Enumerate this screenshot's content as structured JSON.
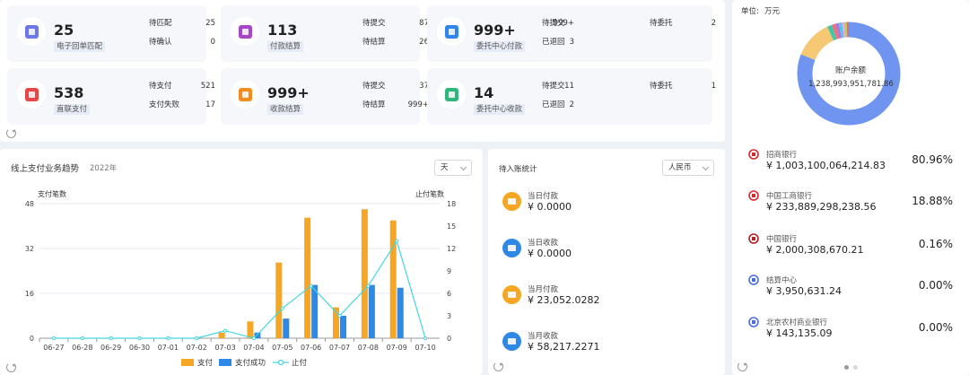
{
  "stats": {
    "cards": [
      {
        "main": "25",
        "sub": "电子回单匹配",
        "icon_color": "#6b78e5",
        "icon": "receipt-icon",
        "kv": [
          {
            "label": "待匹配",
            "value": "25"
          },
          {
            "label": "待确认",
            "value": "0"
          }
        ]
      },
      {
        "main": "113",
        "sub": "付款结算",
        "icon_color": "#a547c8",
        "icon": "payment-icon",
        "kv": [
          {
            "label": "待提交",
            "value": "87"
          },
          {
            "label": "待结算",
            "value": "26"
          }
        ]
      },
      {
        "main": "999+",
        "sub": "委托中心付款",
        "icon_color": "#2f86e8",
        "icon": "wallet-icon",
        "kv": [
          {
            "label": "待提交",
            "value": "999+"
          },
          {
            "label": "已退回",
            "value": "3"
          },
          {
            "label": "待委托",
            "value": "2"
          }
        ]
      },
      {
        "main": "538",
        "sub": "直联支付",
        "icon_color": "#e84646",
        "icon": "card-icon",
        "kv": [
          {
            "label": "待支付",
            "value": "521"
          },
          {
            "label": "支付失败",
            "value": "17"
          }
        ]
      },
      {
        "main": "999+",
        "sub": "收款结算",
        "icon_color": "#f28c1c",
        "icon": "collect-icon",
        "kv": [
          {
            "label": "待提交",
            "value": "37"
          },
          {
            "label": "待结算",
            "value": "999+"
          }
        ]
      },
      {
        "main": "14",
        "sub": "委托中心收款",
        "icon_color": "#2fb67c",
        "icon": "document-icon",
        "kv": [
          {
            "label": "待提交",
            "value": "11"
          },
          {
            "label": "已退回",
            "value": "2"
          },
          {
            "label": "待委托",
            "value": "1"
          }
        ]
      }
    ]
  },
  "trend": {
    "title": "线上支付业务趋势",
    "year": "2022年",
    "select_value": "天"
  },
  "chart_data": {
    "type": "bar",
    "categories": [
      "06-27",
      "06-28",
      "06-29",
      "06-30",
      "07-01",
      "07-02",
      "07-03",
      "07-04",
      "07-05",
      "07-06",
      "07-07",
      "07-08",
      "07-09",
      "07-10"
    ],
    "y_left_label": "支付笔数",
    "y_right_label": "止付笔数",
    "y_left_ticks": [
      "0",
      "16",
      "32",
      "48"
    ],
    "y_right_ticks": [
      "0",
      "3",
      "6",
      "9",
      "12",
      "15",
      "18"
    ],
    "ylim_left": [
      0,
      48
    ],
    "ylim_right": [
      0,
      18
    ],
    "series": [
      {
        "name": "支付",
        "kind": "bar",
        "color": "#f5a623",
        "values": [
          0,
          0,
          0,
          0,
          0,
          0,
          2,
          6,
          27,
          43,
          11,
          46,
          42,
          0
        ]
      },
      {
        "name": "支付成功",
        "kind": "bar",
        "color": "#2e88e6",
        "values": [
          0,
          0,
          0,
          0,
          0,
          0,
          0,
          2,
          7,
          19,
          8,
          19,
          18,
          0
        ]
      },
      {
        "name": "止付",
        "kind": "line",
        "color": "#43d6e0",
        "values": [
          0,
          0,
          0,
          0,
          0,
          0,
          1,
          0,
          4,
          7,
          3,
          7,
          13,
          0
        ]
      }
    ],
    "grid": true,
    "legend": "bottom"
  },
  "pending": {
    "title": "待入账统计",
    "currency": "人民币",
    "items": [
      {
        "label": "当日付款",
        "value": "¥ 0.0000",
        "color": "#f5a623",
        "icon": "payment-out-icon"
      },
      {
        "label": "当日收款",
        "value": "¥ 0.0000",
        "color": "#2e88e6",
        "icon": "payment-in-icon"
      },
      {
        "label": "当月付款",
        "value": "¥ 23,052.0282",
        "color": "#f5a623",
        "icon": "payment-out-icon"
      },
      {
        "label": "当月收款",
        "value": "¥ 58,217.2271",
        "color": "#2e88e6",
        "icon": "payment-in-icon"
      }
    ]
  },
  "account": {
    "unit_label": "单位:",
    "unit_value": "万元",
    "donut_label": "账户余额",
    "donut_value": "1,238,993,951,781.86",
    "donut_segments": [
      {
        "share": 0.8096,
        "color": "#6f95f0"
      },
      {
        "share": 0.12,
        "color": "#f7c873"
      },
      {
        "share": 0.015,
        "color": "#3ec9a8"
      },
      {
        "share": 0.012,
        "color": "#f0707a"
      },
      {
        "share": 0.01,
        "color": "#a777e0"
      },
      {
        "share": 0.01,
        "color": "#53c4ef"
      },
      {
        "share": 0.008,
        "color": "#f2a3d0"
      },
      {
        "share": 0.007,
        "color": "#9bd76b"
      },
      {
        "share": 0.0084,
        "color": "#e5714f"
      }
    ],
    "banks": [
      {
        "name": "招商银行",
        "amount": "¥ 1,003,100,064,214.83",
        "pct": "80.96%",
        "icon": "cmb-bank-icon",
        "color": "#d9272e"
      },
      {
        "name": "中国工商银行",
        "amount": "¥ 233,889,298,238.56",
        "pct": "18.88%",
        "icon": "icbc-bank-icon",
        "color": "#d9272e"
      },
      {
        "name": "中国银行",
        "amount": "¥ 2,000,308,670.21",
        "pct": "0.16%",
        "icon": "boc-bank-icon",
        "color": "#b81c22"
      },
      {
        "name": "结算中心",
        "amount": "¥ 3,950,631.24",
        "pct": "0.00%",
        "icon": "settlement-center-icon",
        "color": "#4a6fd8"
      },
      {
        "name": "北京农村商业银行",
        "amount": "¥ 143,135.09",
        "pct": "0.00%",
        "icon": "bank-building-icon",
        "color": "#4a6fd8"
      }
    ]
  }
}
